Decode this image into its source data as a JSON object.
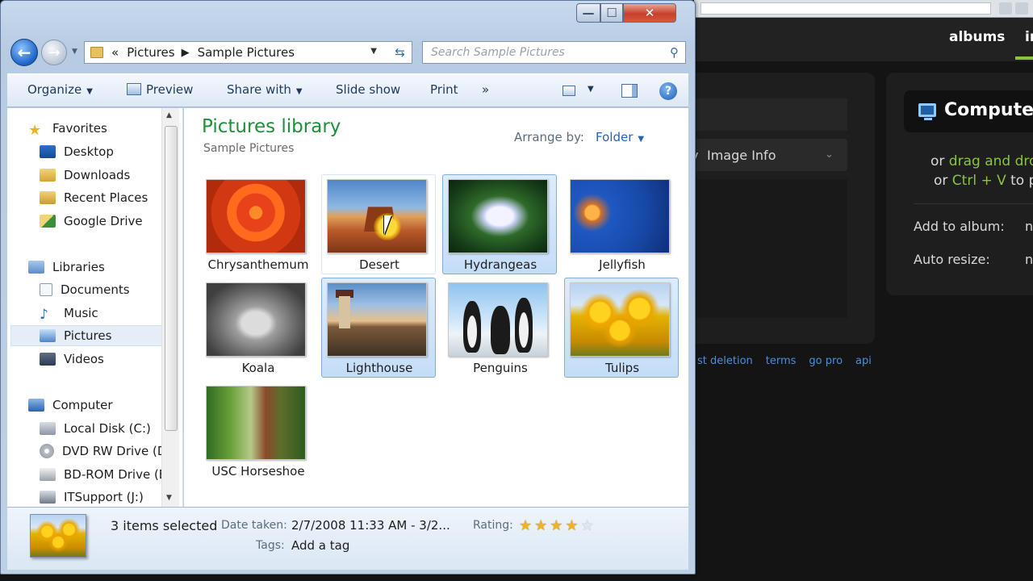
{
  "window": {
    "caption": {
      "minimize": "—",
      "maximize": "☐",
      "close": "✕"
    }
  },
  "nav": {
    "back": "←",
    "forward": "→",
    "address_parts": [
      "«",
      "Pictures",
      "Sample Pictures"
    ],
    "search_placeholder": "Search Sample Pictures"
  },
  "toolbar": {
    "organize": "Organize",
    "preview": "Preview",
    "share_with": "Share with",
    "slide_show": "Slide show",
    "print": "Print",
    "more": "»",
    "help": "?"
  },
  "navpane": {
    "favorites": "Favorites",
    "favorites_items": [
      "Desktop",
      "Downloads",
      "Recent Places",
      "Google Drive"
    ],
    "libraries": "Libraries",
    "libraries_items": [
      "Documents",
      "Music",
      "Pictures",
      "Videos"
    ],
    "selected": "Pictures",
    "computer": "Computer",
    "computer_items": [
      "Local Disk (C:)",
      "DVD RW Drive (D",
      "BD-ROM Drive (E",
      "ITSupport (J:)"
    ]
  },
  "content": {
    "title": "Pictures library",
    "subtitle": "Sample Pictures",
    "arrange_label": "Arrange by:",
    "arrange_value": "Folder",
    "files": [
      {
        "name": "Chrysanthemum",
        "selected": false
      },
      {
        "name": "Desert",
        "selected": false,
        "hover": true
      },
      {
        "name": "Hydrangeas",
        "selected": true
      },
      {
        "name": "Jellyfish",
        "selected": false
      },
      {
        "name": "Koala",
        "selected": false
      },
      {
        "name": "Lighthouse",
        "selected": true
      },
      {
        "name": "Penguins",
        "selected": false
      },
      {
        "name": "Tulips",
        "selected": true
      },
      {
        "name": "USC Horseshoe",
        "selected": false
      }
    ]
  },
  "details": {
    "count": "3 items selected",
    "date_label": "Date taken:",
    "date_value": "2/7/2008 11:33 AM - 3/2...",
    "rating_label": "Rating:",
    "rating": 4,
    "rating_max": 5,
    "tags_label": "Tags:",
    "tags_value": "Add a tag"
  },
  "background_page": {
    "nav_albums": "albums",
    "nav_more": "ir",
    "select_prefix": "v",
    "select_label": "Image Info",
    "panel_title": "Compute",
    "line1_pre": "or ",
    "line1_link": "drag and dro",
    "line2_pre": "or ",
    "line2_link": "Ctrl + V",
    "line2_post": " to p",
    "add_to_album_label": "Add to album:",
    "add_to_album_value": "n",
    "auto_resize_label": "Auto resize:",
    "auto_resize_value": "n",
    "footer_links": [
      "st deletion",
      "terms",
      "go pro",
      "api"
    ]
  },
  "colors": {
    "library_title": "#1e8f3a",
    "link_blue": "#2463b5",
    "site_accent_green": "#8bc43f",
    "selection_fill": "#cde2f8"
  }
}
